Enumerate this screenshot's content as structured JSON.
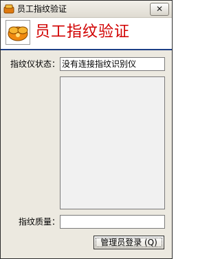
{
  "window": {
    "title": "员工指纹验证"
  },
  "titlebar": {
    "close_label": "✕"
  },
  "header": {
    "title": "员工指纹验证"
  },
  "form": {
    "status_label": "指纹仪状态：",
    "status_value": "没有连接指纹识别仪",
    "quality_label": "指纹质量：",
    "quality_value": ""
  },
  "buttons": {
    "admin_login": "管理员登录 (Q)"
  }
}
